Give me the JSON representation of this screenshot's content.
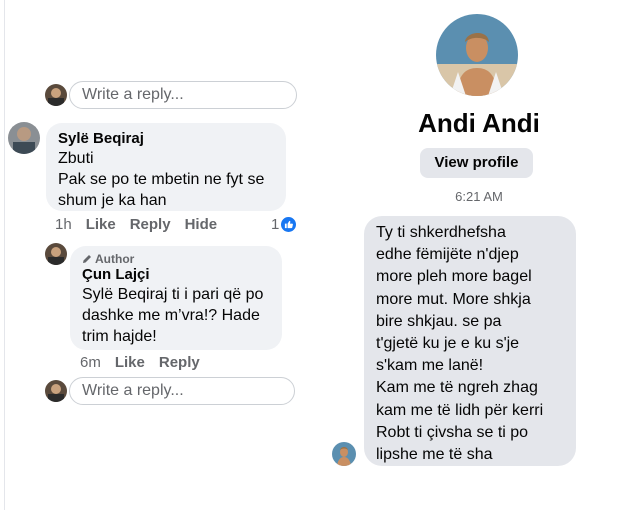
{
  "comments": {
    "reply_placeholder_top": "Write a reply...",
    "comment1": {
      "author": "Sylë Beqiraj",
      "lines": [
        "Zbuti",
        "Pak se po te mbetin ne fyt se",
        "shum je ka han"
      ],
      "time": "1h",
      "like_label": "Like",
      "reply_label": "Reply",
      "hide_label": "Hide",
      "reaction_count": "1"
    },
    "reply1": {
      "badge": "Author",
      "author": "Çun Lajçi",
      "lines": [
        "Sylë Beqiraj ti i pari që po",
        "dashke me m’vra!? Hade",
        "trim hajde!"
      ],
      "time": "6m",
      "like_label": "Like",
      "reply_label": "Reply"
    },
    "reply_placeholder_bottom": "Write a reply..."
  },
  "profile": {
    "name": "Andi Andi",
    "view_profile_label": "View profile",
    "message_time": "6:21 AM",
    "message_lines": [
      "Ty ti shkerdhefsha",
      "edhe fëmijëte n'djep",
      "more pleh more bagel",
      "more mut. More shkja",
      "bire shkjau. se pa",
      "t'gjetë ku je e ku s'je",
      "s'kam me lanë!",
      "Kam me të ngreh zhag",
      "kam me të lidh për kerri",
      "Robt ti çivsha se ti po",
      "lipshe me të sha"
    ]
  },
  "colors": {
    "like_blue": "#1877f2",
    "bubble_gray": "#f0f2f5",
    "secondary_text": "#65676b"
  }
}
